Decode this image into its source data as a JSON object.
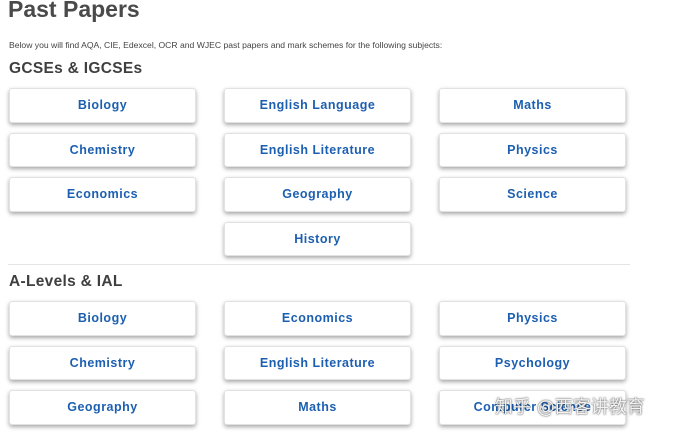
{
  "page": {
    "title": "Past Papers",
    "intro": "Below you will find AQA, CIE, Edexcel, OCR and WJEC past papers and mark schemes for the following subjects:"
  },
  "gcse": {
    "heading": "GCSEs & IGCSEs",
    "subjects": [
      "Biology",
      "English Language",
      "Maths",
      "Chemistry",
      "English Literature",
      "Physics",
      "Economics",
      "Geography",
      "Science",
      "History"
    ]
  },
  "alevel": {
    "heading": "A-Levels & IAL",
    "subjects": [
      "Biology",
      "Economics",
      "Physics",
      "Chemistry",
      "English Literature",
      "Psychology",
      "Geography",
      "Maths",
      "Computer Science"
    ]
  },
  "watermark": {
    "text": "知乎 @西客讲教育"
  },
  "colors": {
    "button_text": "#1c5fb0",
    "heading_text": "#4a4a4a"
  }
}
